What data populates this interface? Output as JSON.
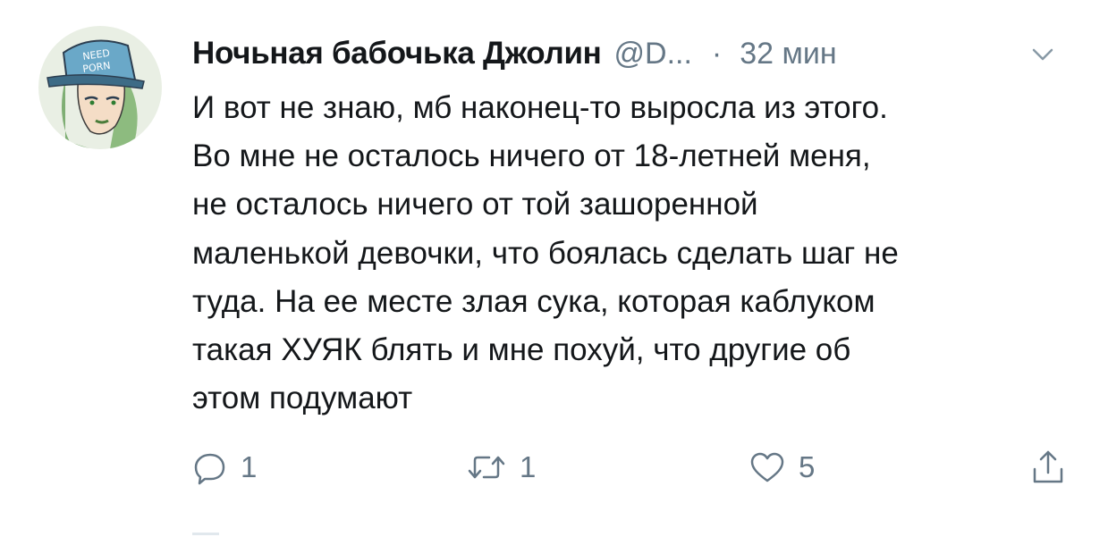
{
  "tweet": {
    "display_name": "Ночьная бабочька Джолин",
    "handle": "@D...",
    "separator": "·",
    "time": "32 мин",
    "avatar_text": "NEED PORN",
    "text_lines": [
      "И вот не знаю, мб наконец-то выросла из этого.",
      "Во мне не осталось ничего от 18-летней меня,",
      "не осталось ничего от той зашоренной",
      "маленькой девочки, что боялась сделать шаг не",
      "туда. На ее месте злая сука, которая каблуком",
      "такая ХУЯК блять и мне похуй, что другие об",
      "этом подумают"
    ],
    "actions": {
      "reply_count": "1",
      "retweet_count": "1",
      "like_count": "5"
    }
  },
  "colors": {
    "text": "#14171a",
    "secondary": "#657786",
    "background": "#ffffff"
  },
  "icons": [
    "chevron-down-icon",
    "reply-icon",
    "retweet-icon",
    "like-icon",
    "share-icon"
  ]
}
